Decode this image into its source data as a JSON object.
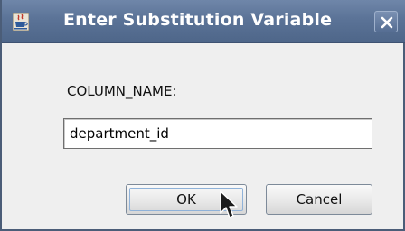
{
  "window": {
    "title": "Enter Substitution Variable",
    "app_icon": "java-coffee-cup-icon",
    "close_icon": "close-icon"
  },
  "form": {
    "variable_label": "COLUMN_NAME:",
    "variable_value": "department_id"
  },
  "buttons": {
    "ok_label": "OK",
    "cancel_label": "Cancel"
  },
  "colors": {
    "titlebar": "#5b7397",
    "dialog_background": "#efefef",
    "title_text": "#ffffff"
  }
}
